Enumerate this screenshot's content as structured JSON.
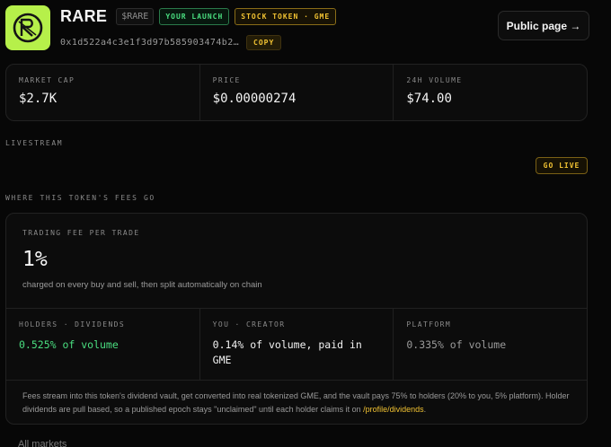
{
  "header": {
    "token_name": "RARE",
    "ticker": "$RARE",
    "badge_launch": "YOUR LAUNCH",
    "badge_stock": "STOCK TOKEN · GME",
    "address": "0x1d522a4c3e1f3d97b585903474b2…",
    "copy_label": "COPY",
    "public_page_label": "Public page →"
  },
  "colors": {
    "accent_gold": "#f1c232",
    "accent_green": "#4ade80",
    "logo_bg": "#b6f04a",
    "background": "#070707"
  },
  "stats": [
    {
      "label": "MARKET CAP",
      "value": "$2.7K"
    },
    {
      "label": "PRICE",
      "value": "$0.00000274"
    },
    {
      "label": "24H VOLUME",
      "value": "$74.00"
    }
  ],
  "livestream": {
    "section_label": "LIVESTREAM",
    "go_live_label": "GO LIVE"
  },
  "fees": {
    "section_label": "WHERE THIS TOKEN'S FEES GO",
    "trading_fee_label": "TRADING FEE PER TRADE",
    "trading_fee_value": "1%",
    "trading_fee_desc": "charged on every buy and sell, then split automatically on chain",
    "splits": [
      {
        "label": "HOLDERS · DIVIDENDS",
        "value": "0.525% of volume"
      },
      {
        "label": "YOU · CREATOR",
        "value": "0.14% of volume, paid in GME"
      },
      {
        "label": "PLATFORM",
        "value": "0.335% of volume"
      }
    ],
    "note_text": "Fees stream into this token's dividend vault, get converted into real tokenized GME, and the vault pays 75% to holders (20% to you, 5% platform). Holder dividends are pull based, so a published epoch stays \"unclaimed\" until each holder claims it on ",
    "note_link": "/profile/dividends",
    "note_end": "."
  },
  "footer": {
    "partial_text": "All markets"
  },
  "icons": {
    "logo": "rare-logo-icon"
  }
}
